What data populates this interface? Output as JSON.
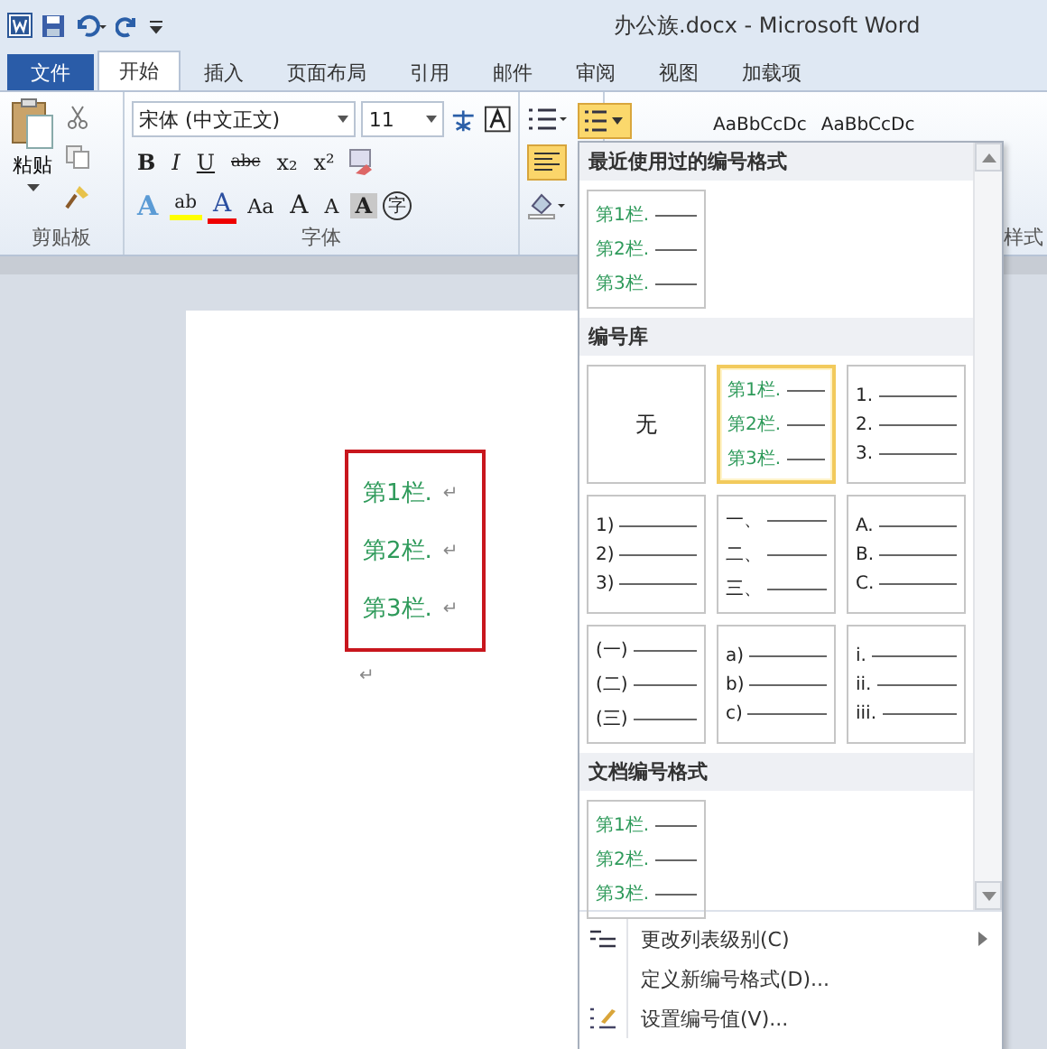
{
  "window": {
    "title": "办公族.docx - Microsoft Word"
  },
  "tabs": [
    {
      "label": "文件",
      "kind": "file",
      "selected": false
    },
    {
      "label": "开始",
      "kind": "tab",
      "selected": true
    },
    {
      "label": "插入",
      "kind": "tab",
      "selected": false
    },
    {
      "label": "页面布局",
      "kind": "tab",
      "selected": false
    },
    {
      "label": "引用",
      "kind": "tab",
      "selected": false
    },
    {
      "label": "邮件",
      "kind": "tab",
      "selected": false
    },
    {
      "label": "审阅",
      "kind": "tab",
      "selected": false
    },
    {
      "label": "视图",
      "kind": "tab",
      "selected": false
    },
    {
      "label": "加载项",
      "kind": "tab",
      "selected": false
    }
  ],
  "clipboard": {
    "paste": "粘贴",
    "group": "剪贴板"
  },
  "font": {
    "name": "宋体 (中文正文)",
    "size": "11",
    "group": "字体",
    "row1": [
      "B",
      "I",
      "U",
      "abc",
      "x₂",
      "x²"
    ],
    "row2": [
      {
        "label": "A",
        "kind": "effect"
      },
      {
        "label": "ab",
        "kind": "highlight"
      },
      {
        "label": "A",
        "kind": "color"
      },
      {
        "label": "Aa",
        "kind": "case"
      },
      {
        "label": "A",
        "kind": "grow"
      },
      {
        "label": "A",
        "kind": "shrink"
      },
      {
        "label": "A",
        "kind": "shade"
      },
      {
        "label": "字",
        "kind": "enclose"
      }
    ]
  },
  "styles": {
    "samples": [
      "AaBbCcDc",
      "AaBbCcDc"
    ],
    "group": "样式"
  },
  "document": {
    "items": [
      {
        "text": "第1栏.",
        "pilcrow": "↵"
      },
      {
        "text": "第2栏.",
        "pilcrow": "↵"
      },
      {
        "text": "第3栏.",
        "pilcrow": "↵"
      }
    ],
    "trailing": "↵"
  },
  "numbering_menu": {
    "sections": [
      {
        "title": "最近使用过的编号格式",
        "tiles": [
          {
            "kind": "styled",
            "selected": false,
            "labels": [
              "第1栏.",
              "第2栏.",
              "第3栏."
            ]
          }
        ]
      },
      {
        "title": "编号库",
        "tiles": [
          {
            "kind": "none",
            "selected": false,
            "labels": [
              "无"
            ]
          },
          {
            "kind": "styled",
            "selected": true,
            "labels": [
              "第1栏.",
              "第2栏.",
              "第3栏."
            ]
          },
          {
            "kind": "plain",
            "selected": false,
            "labels": [
              "1.",
              "2.",
              "3."
            ]
          },
          {
            "kind": "plain",
            "selected": false,
            "labels": [
              "1)",
              "2)",
              "3)"
            ]
          },
          {
            "kind": "plain",
            "selected": false,
            "labels": [
              "一、",
              "二、",
              "三、"
            ]
          },
          {
            "kind": "plain",
            "selected": false,
            "labels": [
              "A.",
              "B.",
              "C."
            ]
          },
          {
            "kind": "plain",
            "selected": false,
            "labels": [
              "(一)",
              "(二)",
              "(三)"
            ]
          },
          {
            "kind": "plain",
            "selected": false,
            "labels": [
              "a)",
              "b)",
              "c)"
            ]
          },
          {
            "kind": "plain",
            "selected": false,
            "labels": [
              "i.",
              "ii.",
              "iii."
            ]
          }
        ]
      },
      {
        "title": "文档编号格式",
        "tiles": [
          {
            "kind": "styled",
            "selected": false,
            "labels": [
              "第1栏.",
              "第2栏.",
              "第3栏."
            ]
          }
        ]
      }
    ],
    "commands": [
      {
        "label": "更改列表级别(C)",
        "kind": "level",
        "submenu": true
      },
      {
        "label": "定义新编号格式(D)...",
        "kind": "plain",
        "submenu": false
      },
      {
        "label": "设置编号值(V)...",
        "kind": "value",
        "submenu": false
      }
    ]
  }
}
